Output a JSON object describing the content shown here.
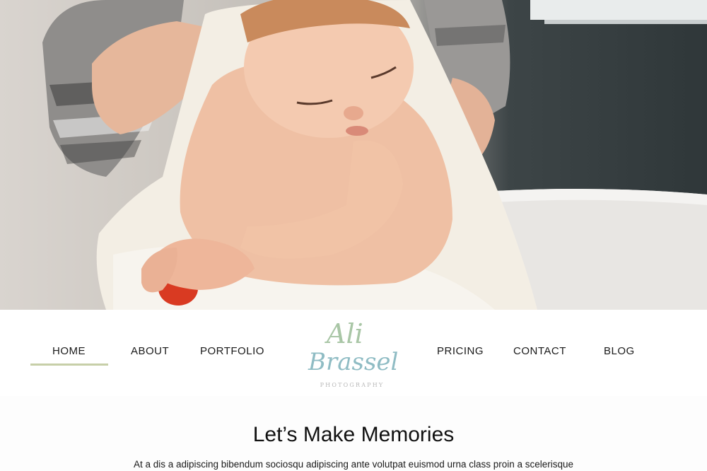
{
  "hero": {
    "image": "baby-in-towel-photo"
  },
  "nav": {
    "left_items": [
      {
        "label": "HOME",
        "active": true
      },
      {
        "label": "ABOUT",
        "active": false
      },
      {
        "label": "PORTFOLIO",
        "active": false
      }
    ],
    "right_items": [
      {
        "label": "PRICING",
        "active": false
      },
      {
        "label": "CONTACT",
        "active": false
      },
      {
        "label": "BLOG",
        "active": false
      }
    ],
    "logo": {
      "line1": "Ali",
      "line2": "Brassel",
      "sub": "PHOTOGRAPHY"
    }
  },
  "content": {
    "headline": "Let’s Make Memories",
    "body": "At a dis a adipiscing bibendum sociosqu adipiscing ante volutpat euismod urna class proin a scelerisque"
  },
  "colors": {
    "active_underline": "#c7cfa8",
    "logo_green": "#a9c6a6",
    "logo_blue": "#8fbcc4",
    "text": "#111111"
  }
}
